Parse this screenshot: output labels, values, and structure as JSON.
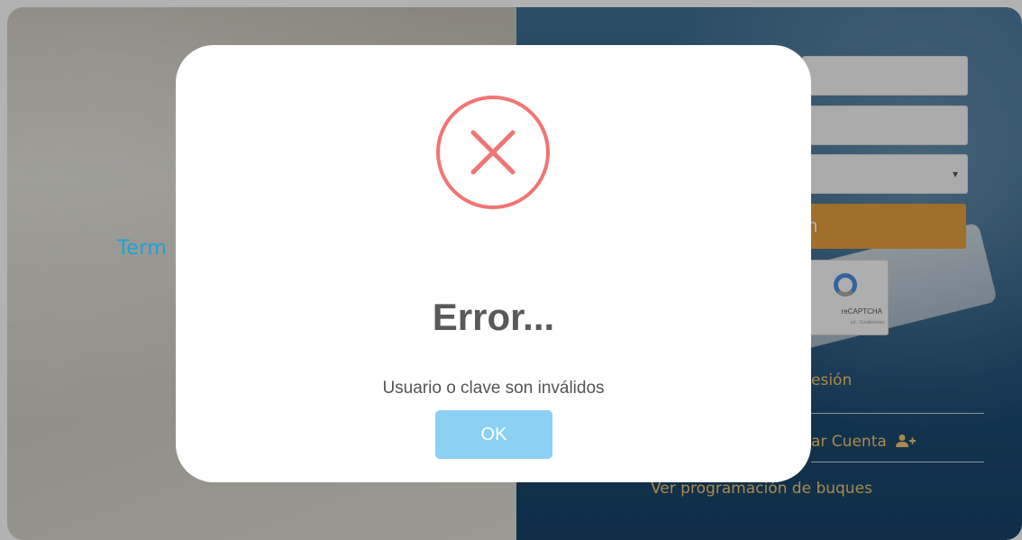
{
  "background": {
    "brand_text": "Term",
    "login_button_label": "n",
    "select_arrow": "▾",
    "recaptcha": {
      "label": "reCAPTCHA",
      "sub_label": "cd - Condiciones"
    },
    "login_link_label": "esión",
    "create_account_label": "ar Cuenta",
    "schedule_link_label": "Ver programación de buques"
  },
  "dialog": {
    "icon": "error-x-icon",
    "title": "Error...",
    "message": "Usuario o clave son inválidos",
    "ok_label": "OK"
  },
  "colors": {
    "error_icon": "#f27474",
    "ok_button": "#8cd0f3",
    "link": "#f2c66e",
    "login_button": "#e6a03e",
    "brand": "#1aa3d6"
  }
}
